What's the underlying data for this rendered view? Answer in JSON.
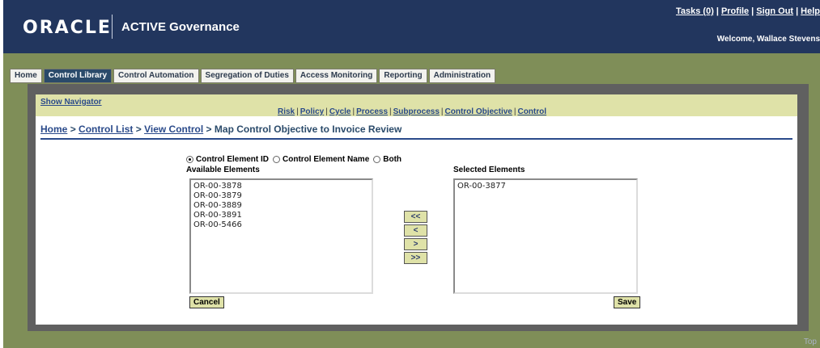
{
  "header": {
    "logo": "ORACLE",
    "product": "ACTIVE Governance",
    "links": [
      "Tasks (0)",
      "Profile",
      "Sign Out",
      "Help"
    ],
    "welcome": "Welcome, Wallace Stevens"
  },
  "tabs": [
    {
      "label": "Home",
      "active": false
    },
    {
      "label": "Control Library",
      "active": true
    },
    {
      "label": "Control Automation",
      "active": false
    },
    {
      "label": "Segregation of Duties",
      "active": false
    },
    {
      "label": "Access Monitoring",
      "active": false
    },
    {
      "label": "Reporting",
      "active": false
    },
    {
      "label": "Administration",
      "active": false
    }
  ],
  "subbar": {
    "show_navigator": "Show Navigator",
    "links": [
      "Risk",
      "Policy",
      "Cycle",
      "Process",
      "Subprocess",
      "Control Objective",
      "Control"
    ]
  },
  "breadcrumb": {
    "links": [
      "Home",
      "Control List",
      "View Control"
    ],
    "separator": ">",
    "current": "Map Control Objective to Invoice Review"
  },
  "radios": [
    {
      "label": "Control Element ID",
      "checked": true
    },
    {
      "label": "Control Element Name",
      "checked": false
    },
    {
      "label": "Both",
      "checked": false
    }
  ],
  "available": {
    "label": "Available Elements",
    "items": [
      "OR-00-3878",
      "OR-00-3879",
      "OR-00-3889",
      "OR-00-3891",
      "OR-00-5466"
    ]
  },
  "selected": {
    "label": "Selected Elements",
    "items": [
      "OR-00-3877"
    ]
  },
  "move_buttons": [
    "<<",
    "<",
    ">",
    ">>"
  ],
  "actions": {
    "cancel": "Cancel",
    "save": "Save"
  },
  "footer": {
    "top": "Top"
  },
  "colors": {
    "header_bg": "#22365e",
    "band_bg": "#7f8e58",
    "subbar_bg": "#dfe2a8",
    "frame": "#606060"
  }
}
